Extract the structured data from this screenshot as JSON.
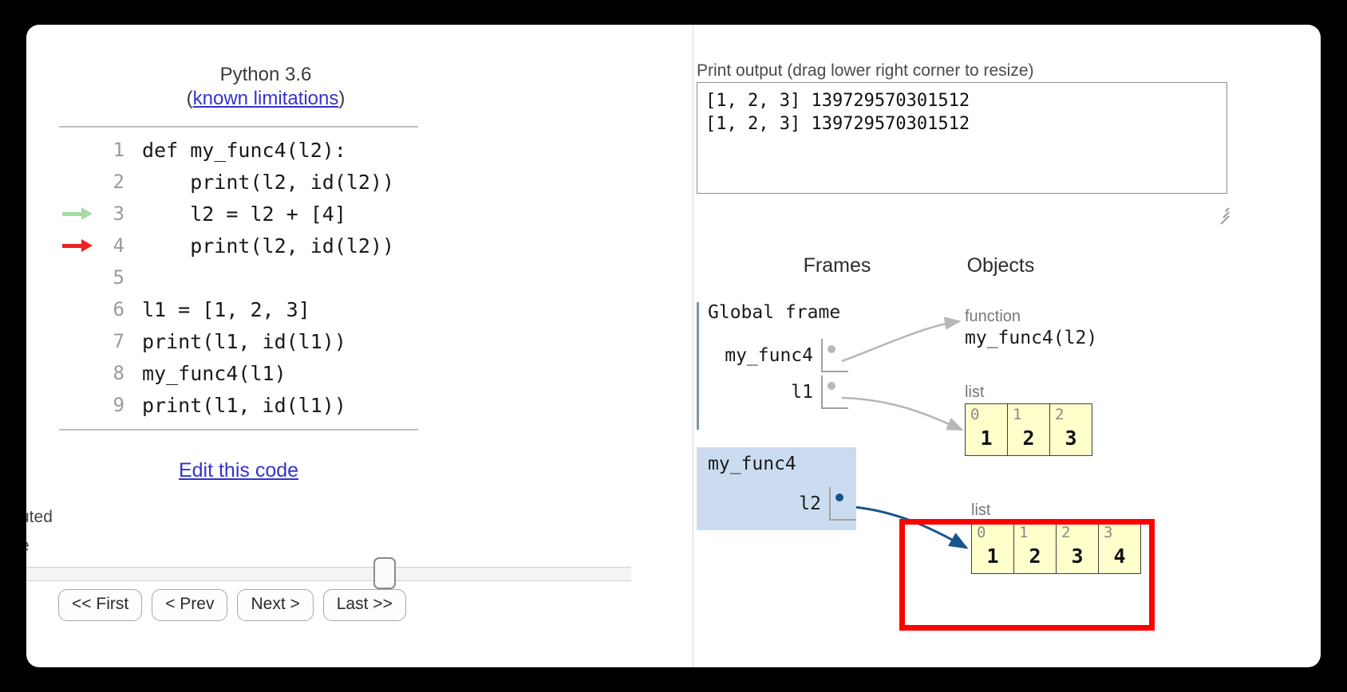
{
  "app": {
    "python_version": "Python 3.6",
    "limitations_prefix": "(",
    "limitations_link": "known limitations",
    "limitations_suffix": ")",
    "edit_link": "Edit this code"
  },
  "code": {
    "lines": [
      {
        "num": "1",
        "text": "def my_func4(l2):",
        "marker": "none"
      },
      {
        "num": "2",
        "text": "    print(l2, id(l2))",
        "marker": "none"
      },
      {
        "num": "3",
        "text": "    l2 = l2 + [4]",
        "marker": "green"
      },
      {
        "num": "4",
        "text": "    print(l2, id(l2))",
        "marker": "red"
      },
      {
        "num": "5",
        "text": "",
        "marker": "none"
      },
      {
        "num": "6",
        "text": "l1 = [1, 2, 3]",
        "marker": "none"
      },
      {
        "num": "7",
        "text": "print(l1, id(l1))",
        "marker": "none"
      },
      {
        "num": "8",
        "text": "my_func4(l1)",
        "marker": "none"
      },
      {
        "num": "9",
        "text": "print(l1, id(l1))",
        "marker": "none"
      }
    ]
  },
  "status": {
    "clipped_line1": "uted",
    "clipped_line2": "e"
  },
  "controls": {
    "first": "<< First",
    "prev": "< Prev",
    "next": "Next >",
    "last": "Last >>"
  },
  "output": {
    "label": "Print output (drag lower right corner to resize)",
    "lines": [
      "[1, 2, 3] 139729570301512",
      "[1, 2, 3] 139729570301512"
    ]
  },
  "viz": {
    "frames_title": "Frames",
    "objects_title": "Objects",
    "frames": [
      {
        "name": "Global frame",
        "highlighted": false,
        "vars": [
          {
            "name": "my_func4"
          },
          {
            "name": "l1"
          }
        ]
      },
      {
        "name": "my_func4",
        "highlighted": true,
        "vars": [
          {
            "name": "l2"
          }
        ]
      }
    ],
    "objects": [
      {
        "type": "function",
        "label": "my_func4(l2)"
      },
      {
        "type": "list",
        "indices": [
          "0",
          "1",
          "2"
        ],
        "values": [
          "1",
          "2",
          "3"
        ],
        "highlighted": false
      },
      {
        "type": "list",
        "indices": [
          "0",
          "1",
          "2",
          "3"
        ],
        "values": [
          "1",
          "2",
          "3",
          "4"
        ],
        "highlighted": true
      }
    ]
  },
  "colors": {
    "highlight_frame": "#ccdcf0",
    "list_cell": "#ffffcc",
    "red_box": "#ff0000",
    "active_arrow": "#17558a",
    "inactive_arrow": "#b7b7b7",
    "green_marker": "#a6dba6",
    "red_marker": "#ee2222",
    "link": "#3333cc"
  }
}
